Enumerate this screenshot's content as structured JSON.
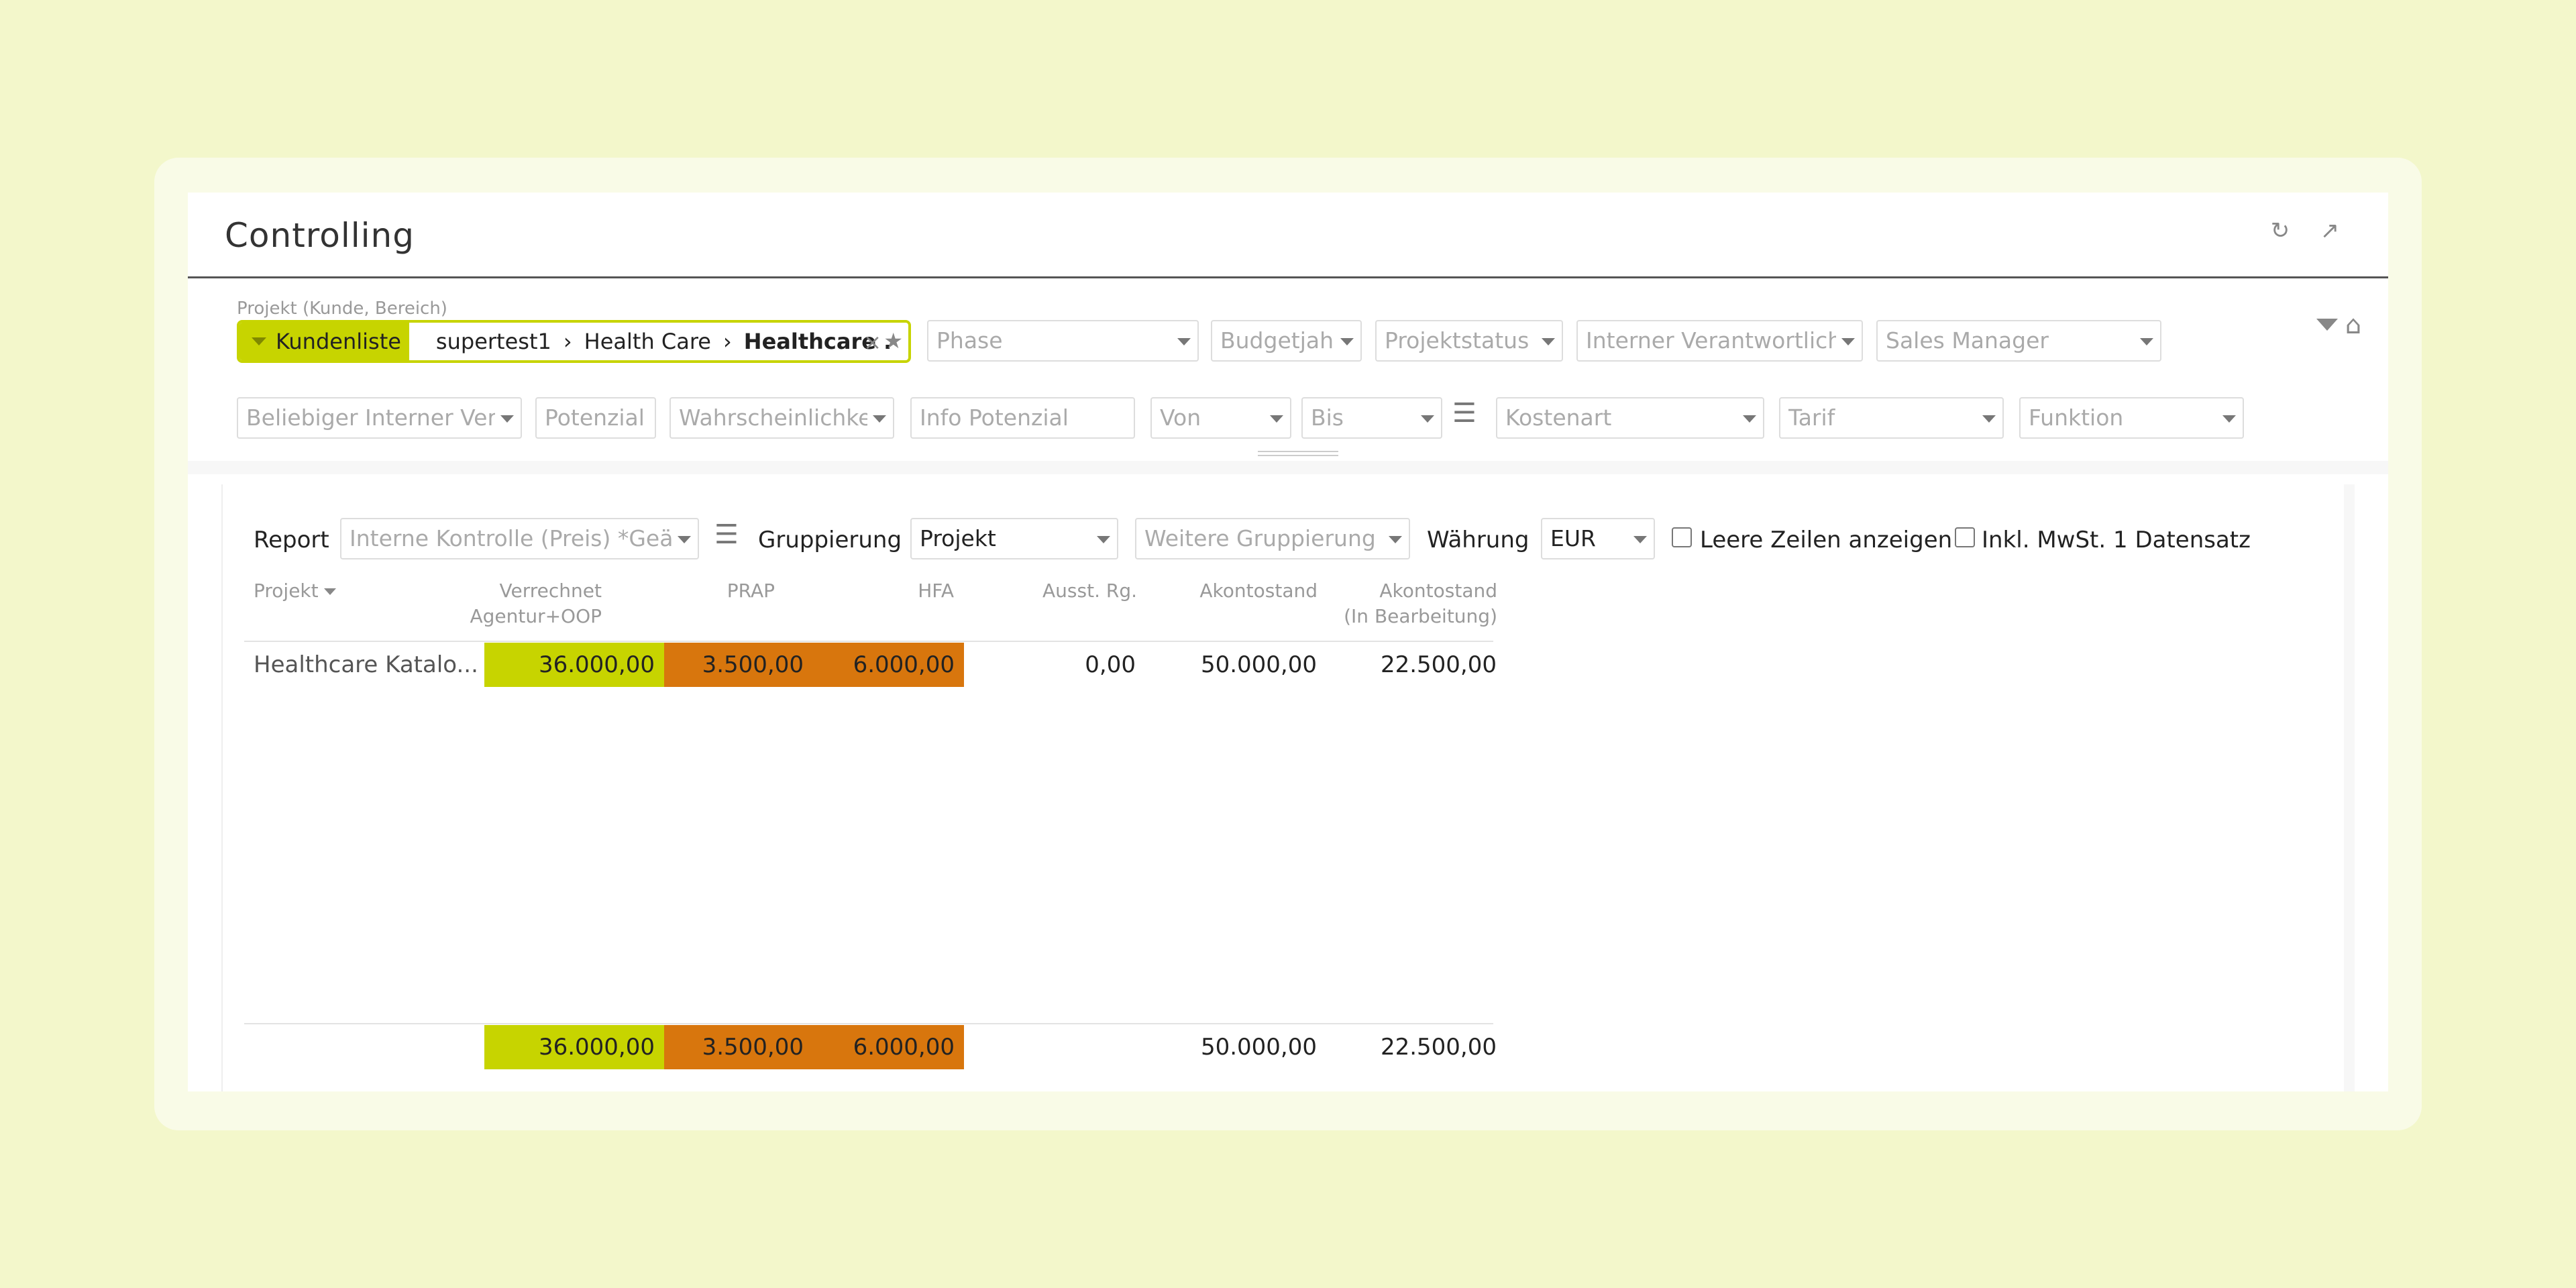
{
  "header": {
    "title": "Controlling",
    "icons": [
      "refresh-icon",
      "expand-icon"
    ]
  },
  "filters": {
    "project_label": "Projekt (Kunde, Bereich)",
    "kundenliste": "Kundenliste",
    "crumbs": [
      "supertest1",
      "›",
      "Health Care",
      "›",
      "Healthcare ."
    ],
    "row1": {
      "phase": "Phase",
      "budgetjahr": "Budgetjah",
      "projektstatus": "Projektstatus",
      "interner_verantwortlicher": "Interner Verantwortlich",
      "sales_manager": "Sales Manager"
    },
    "row2": {
      "beliebiger": "Beliebiger Interner Ver",
      "potenzial": "Potenzial",
      "wahrscheinlichkeit": "Wahrscheinlichke",
      "info_potenzial": "Info Potenzial",
      "von": "Von",
      "bis": "Bis",
      "kostenart": "Kostenart",
      "tarif": "Tarif",
      "funktion": "Funktion"
    }
  },
  "report": {
    "report_label": "Report",
    "report_value": "Interne Kontrolle (Preis) *Geär",
    "gruppierung_label": "Gruppierung",
    "gruppierung_value": "Projekt",
    "weitere_gruppierung": "Weitere Gruppierung",
    "waehrung_label": "Währung",
    "waehrung_value": "EUR",
    "leere_zeilen": "Leere Zeilen anzeigen",
    "inkl_mwst": "Inkl. MwSt.",
    "datensatz": "1 Datensatz"
  },
  "table": {
    "headers": {
      "projekt": "Projekt",
      "verrechnet_1": "Verrechnet",
      "verrechnet_2": "Agentur+OOP",
      "prap": "PRAP",
      "hfa": "HFA",
      "ausst": "Ausst. Rg.",
      "akontostand": "Akontostand",
      "akonto_bearb_1": "Akontostand",
      "akonto_bearb_2": "(In Bearbeitung)"
    },
    "row": {
      "projekt": "Healthcare Katalo...",
      "verrechnet": "36.000,00",
      "prap": "3.500,00",
      "hfa": "6.000,00",
      "ausst": "0,00",
      "akontostand": "50.000,00",
      "akonto_bearb": "22.500,00"
    },
    "totals": {
      "verrechnet": "36.000,00",
      "prap": "3.500,00",
      "hfa": "6.000,00",
      "akontostand": "50.000,00",
      "akonto_bearb": "22.500,00"
    }
  },
  "colors": {
    "accent_green": "#c7d400",
    "accent_orange": "#d8760d",
    "background": "#f3f7cb"
  }
}
